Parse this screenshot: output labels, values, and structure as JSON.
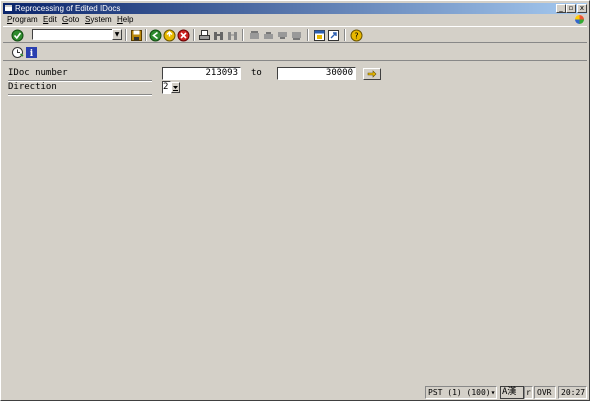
{
  "window": {
    "title": "Reprocessing of Edited IDocs",
    "controls": {
      "minimize": "_",
      "restore": "▫",
      "close": "x"
    }
  },
  "menubar": {
    "items": [
      {
        "label": "Program",
        "accel": "P",
        "rest": "rogram"
      },
      {
        "label": "Edit",
        "accel": "E",
        "rest": "dit"
      },
      {
        "label": "Goto",
        "accel": "G",
        "rest": "oto"
      },
      {
        "label": "System",
        "accel": "S",
        "rest": "ystem"
      },
      {
        "label": "Help",
        "accel": "H",
        "rest": "elp"
      }
    ]
  },
  "toolbar": {
    "command_field_value": "",
    "icons": [
      "enter-icon",
      "command-dropdown-icon",
      "save-icon",
      "back-icon",
      "exit-icon",
      "cancel-icon",
      "print-icon",
      "find-icon",
      "find-next-icon",
      "first-page-icon",
      "previous-page-icon",
      "next-page-icon",
      "last-page-icon",
      "create-session-icon",
      "shortcut-icon",
      "help-icon"
    ]
  },
  "appbar": {
    "icons": [
      "execute-icon",
      "information-icon"
    ]
  },
  "form": {
    "idoc_number_label": "IDoc number",
    "idoc_from": "213093",
    "to_label": "to",
    "idoc_to": "30000",
    "direction_label": "Direction",
    "direction_value": "2"
  },
  "colors": {
    "titlebar_start": "#0a246a",
    "titlebar_end": "#a6caf0",
    "background": "#d4d0c8"
  },
  "statusbar": {
    "system": "PST (1) (100)",
    "dropdown_arrow": "▾",
    "ime": "A漢",
    "extra": "r",
    "mode": "OVR",
    "time": "20:27"
  }
}
